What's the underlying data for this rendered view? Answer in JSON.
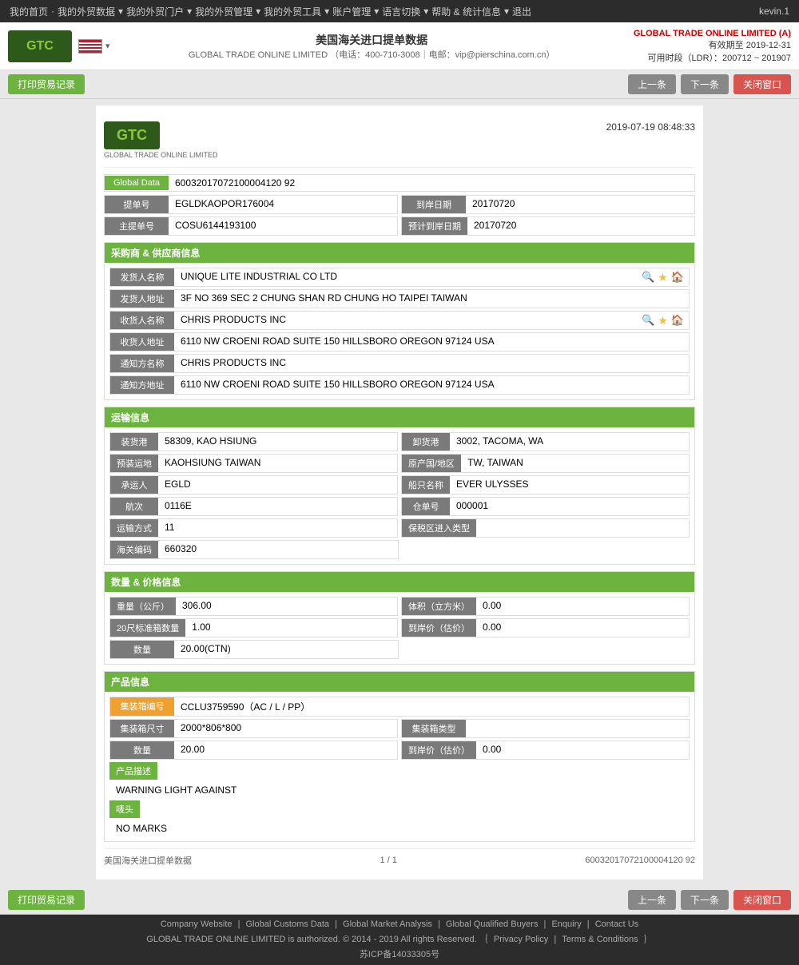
{
  "nav": {
    "items": [
      "我的首页",
      "我的外贸数据",
      "我的外贸门户",
      "我的外贸管理",
      "我的外贸工具",
      "账户管理",
      "语言切换",
      "帮助 & 统计信息",
      "退出"
    ],
    "user": "kevin.1"
  },
  "header": {
    "title": "美国海关进口提单数据",
    "company_name": "GLOBAL TRADE ONLINE LIMITED",
    "contact": "电话：400-710-3008｜电邮：vip@pierschina.com.cn",
    "brand": "GLOBAL TRADE ONLINE LIMITED (A)",
    "valid_until": "有效期至 2019-12-31",
    "ldr": "可用时段（LDR）：200712 ~ 201907"
  },
  "toolbar": {
    "print_btn": "打印贸易记录",
    "prev_btn": "上一条",
    "next_btn": "下一条",
    "close_btn": "关闭窗口"
  },
  "doc": {
    "datetime": "2019-07-19 08:48:33",
    "logo_main": "GTC",
    "logo_sub": "GLOBAL TRADE ONLINE LIMITED",
    "global_data_label": "Global Data",
    "global_data_value": "60032017072100004120 92",
    "bill_label": "提单号",
    "bill_value": "EGLDKAOPOR176004",
    "arrival_date_label": "到岸日期",
    "arrival_date_value": "20170720",
    "master_bill_label": "主提单号",
    "master_bill_value": "COSU6144193100",
    "est_arrival_label": "预计到岸日期",
    "est_arrival_value": "20170720"
  },
  "shipper": {
    "section_title": "采购商 & 供应商信息",
    "shipper_name_label": "发货人名称",
    "shipper_name_value": "UNIQUE LITE INDUSTRIAL CO LTD",
    "shipper_addr_label": "发货人地址",
    "shipper_addr_value": "3F NO 369 SEC 2 CHUNG SHAN RD CHUNG HO TAIPEI TAIWAN",
    "consignee_name_label": "收货人名称",
    "consignee_name_value": "CHRIS PRODUCTS INC",
    "consignee_addr_label": "收货人地址",
    "consignee_addr_value": "6110 NW CROENI ROAD SUITE 150 HILLSBORO OREGON 97124 USA",
    "notify_name_label": "通知方名称",
    "notify_name_value": "CHRIS PRODUCTS INC",
    "notify_addr_label": "通知方地址",
    "notify_addr_value": "6110 NW CROENI ROAD SUITE 150 HILLSBORO OREGON 97124 USA"
  },
  "transport": {
    "section_title": "运输信息",
    "origin_port_label": "装货港",
    "origin_port_value": "58309, KAO HSIUNG",
    "dest_port_label": "卸货港",
    "dest_port_value": "3002, TACOMA, WA",
    "load_place_label": "预装运地",
    "load_place_value": "KAOHSIUNG TAIWAN",
    "country_label": "原产国/地区",
    "country_value": "TW, TAIWAN",
    "carrier_label": "承运人",
    "carrier_value": "EGLD",
    "vessel_label": "船只名称",
    "vessel_value": "EVER ULYSSES",
    "voyage_label": "航次",
    "voyage_value": "0116E",
    "warehouse_label": "仓单号",
    "warehouse_value": "000001",
    "transport_mode_label": "运输方式",
    "transport_mode_value": "11",
    "bonded_label": "保税区进入类型",
    "bonded_value": "",
    "customs_label": "海关编码",
    "customs_value": "660320"
  },
  "quantity": {
    "section_title": "数量 & 价格信息",
    "weight_label": "重量（公斤）",
    "weight_value": "306.00",
    "volume_label": "体积（立方米）",
    "volume_value": "0.00",
    "container20_label": "20尺标准箱数量",
    "container20_value": "1.00",
    "arrival_price_label": "到岸价（估价）",
    "arrival_price_value": "0.00",
    "qty_label": "数量",
    "qty_value": "20.00(CTN)"
  },
  "product": {
    "section_title": "产品信息",
    "container_no_label": "集装箱编号",
    "container_no_value": "CCLU3759590（AC / L / PP）",
    "container_size_label": "集装箱尺寸",
    "container_size_value": "2000*806*800",
    "container_type_label": "集装箱类型",
    "container_type_value": "",
    "qty_label": "数量",
    "qty_value": "20.00",
    "arrival_price_label": "到岸价（估价）",
    "arrival_price_value": "0.00",
    "desc_label": "产品描述",
    "desc_value": "WARNING LIGHT AGAINST",
    "marks_label": "唛头",
    "marks_value": "NO MARKS"
  },
  "footer": {
    "source": "美国海关进口提单数据",
    "page": "1 / 1",
    "record_id": "60032017072100004120 92"
  },
  "page_footer": {
    "links": [
      "Company Website",
      "Global Customs Data",
      "Global Market Analysis",
      "Global Qualified Buyers",
      "Enquiry",
      "Contact Us"
    ],
    "copyright": "GLOBAL TRADE ONLINE LIMITED is authorized. © 2014 - 2019 All rights Reserved. ｛",
    "privacy": "Privacy Policy",
    "terms": "Terms & Conditions",
    "end": "｝",
    "icp": "苏ICP备14033305号"
  }
}
